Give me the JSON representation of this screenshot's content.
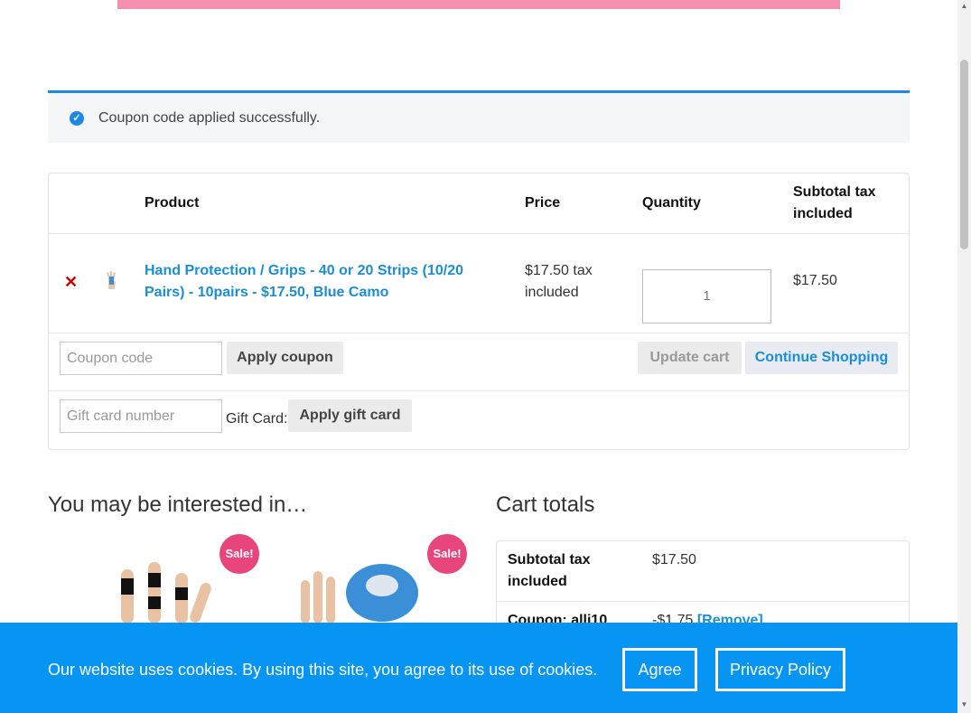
{
  "notice": {
    "message": "Coupon code applied successfully."
  },
  "cart": {
    "headers": {
      "product": "Product",
      "price": "Price",
      "quantity": "Quantity",
      "subtotal": "Subtotal tax included"
    },
    "items": [
      {
        "name": "Hand Protection / Grips - 40 or 20 Strips (10/20 Pairs) - 10pairs - $17.50, Blue Camo",
        "price": "$17.50 tax included",
        "quantity": "1",
        "subtotal": "$17.50"
      }
    ],
    "coupon_placeholder": "Coupon code",
    "apply_coupon": "Apply coupon",
    "update_cart": "Update cart",
    "continue_shopping": "Continue Shopping",
    "gift_placeholder": "Gift card number",
    "gift_label": "Gift Card:",
    "apply_gift": "Apply gift card"
  },
  "interested": {
    "title": "You may be interested in…",
    "badges": [
      "Sale!",
      "Sale!"
    ]
  },
  "totals": {
    "title": "Cart totals",
    "rows": [
      {
        "label": "Subtotal tax included",
        "value": "$17.50"
      },
      {
        "label": "Coupon: alli10",
        "value": "-$1.75",
        "link": "[Remove]"
      }
    ]
  },
  "cookie": {
    "text": "Our website uses cookies. By using this site, you agree to its use of cookies.",
    "agree": "Agree",
    "privacy": "Privacy Policy"
  },
  "colors": {
    "accent": "#1a8fd6",
    "banner": "#0795f4",
    "sale": "#e8457c",
    "top_bar": "#f58fae"
  }
}
